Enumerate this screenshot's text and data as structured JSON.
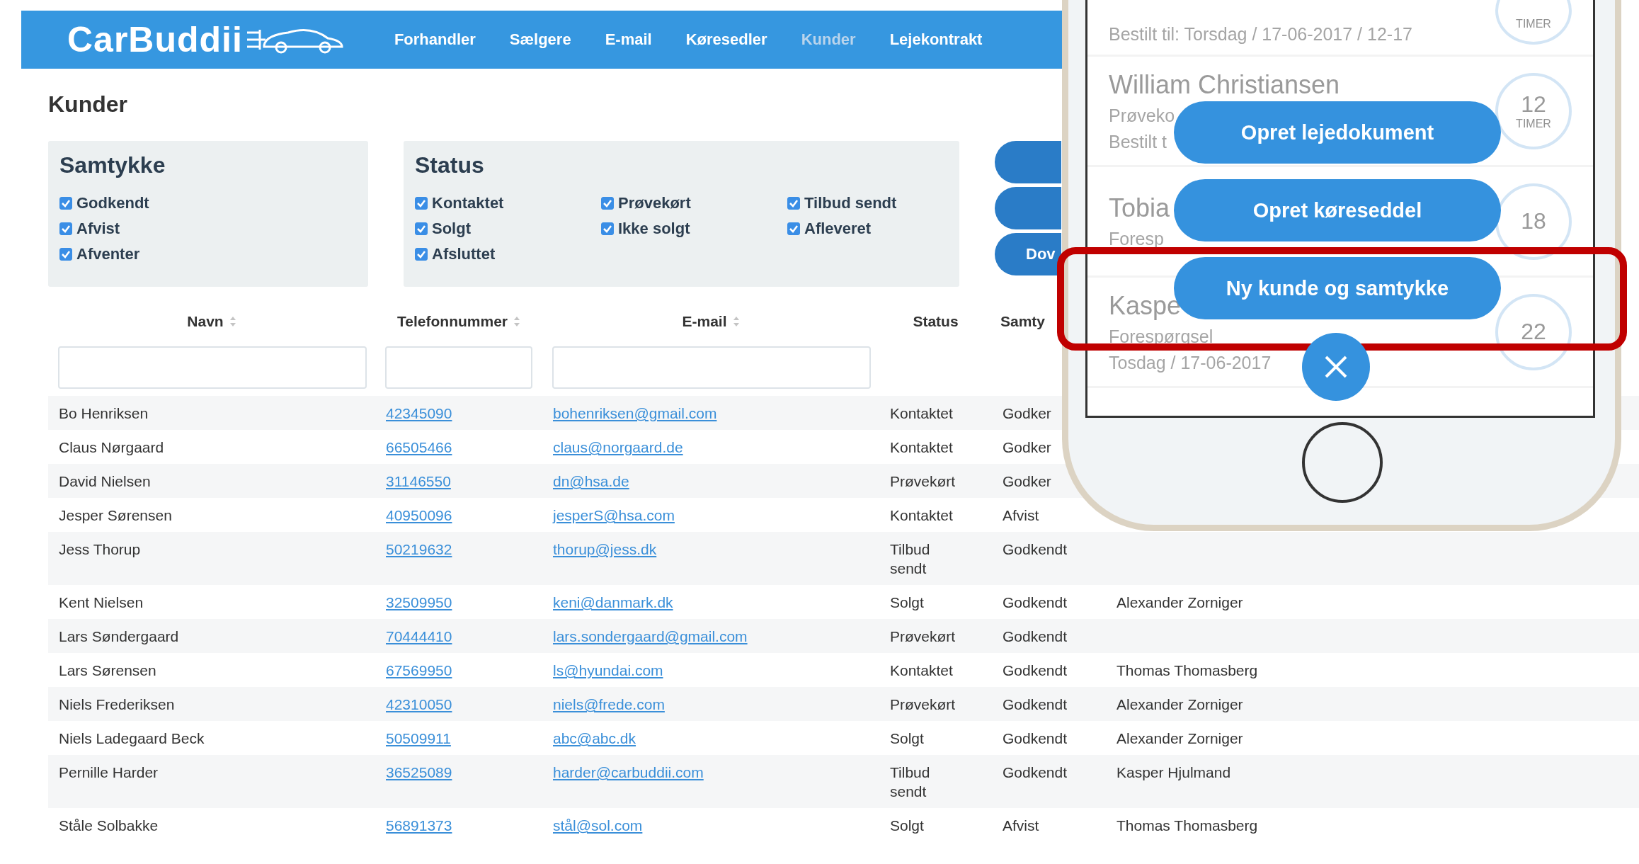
{
  "navbar": {
    "logo": "CarBuddii",
    "items": [
      {
        "label": "Forhandler",
        "selected": false
      },
      {
        "label": "Sælgere",
        "selected": false
      },
      {
        "label": "E-mail",
        "selected": false
      },
      {
        "label": "Køresedler",
        "selected": false
      },
      {
        "label": "Kunder",
        "selected": true
      },
      {
        "label": "Lejekontrakt",
        "selected": false
      }
    ]
  },
  "page_title": "Kunder",
  "filters": [
    {
      "title": "Samtykke",
      "items": [
        {
          "label": "Godkendt",
          "checked": true
        },
        {
          "label": "Afvist",
          "checked": true
        },
        {
          "label": "Afventer",
          "checked": true
        }
      ]
    },
    {
      "title": "Status",
      "items": [
        {
          "label": "Kontaktet",
          "checked": true
        },
        {
          "label": "Prøvekørt",
          "checked": true
        },
        {
          "label": "Tilbud sendt",
          "checked": true
        },
        {
          "label": "Solgt",
          "checked": true
        },
        {
          "label": "Ikke solgt",
          "checked": true
        },
        {
          "label": "Afleveret",
          "checked": true
        },
        {
          "label": "Afsluttet",
          "checked": true
        }
      ]
    }
  ],
  "side_buttons": [
    {
      "kind": "blank"
    },
    {
      "kind": "blank"
    },
    {
      "kind": "labeled",
      "label": "Dov"
    }
  ],
  "table": {
    "columns": [
      {
        "label": "Navn",
        "sortable": true,
        "filter": true
      },
      {
        "label": "Telefonnummer",
        "sortable": true,
        "filter": true
      },
      {
        "label": "E-mail",
        "sortable": true,
        "filter": true
      },
      {
        "label": "Status",
        "sortable": false,
        "filter": false
      },
      {
        "label": "Samty",
        "sortable": false,
        "filter": false
      }
    ],
    "rows": [
      {
        "name": "Bo Henriksen",
        "phone": "42345090",
        "email": "bohenriksen@gmail.com",
        "status": "Kontaktet",
        "consent": "Godker"
      },
      {
        "name": "Claus Nørgaard",
        "phone": "66505466",
        "email": "claus@norgaard.de",
        "status": "Kontaktet",
        "consent": "Godker"
      },
      {
        "name": "David Nielsen",
        "phone": "31146550",
        "email": "dn@hsa.de",
        "status": "Prøvekørt",
        "consent": "Godker"
      },
      {
        "name": "Jesper Sørensen",
        "phone": "40950096",
        "email": "jesperS@hsa.com",
        "status": "Kontaktet",
        "consent": "Afvist"
      },
      {
        "name": "Jess Thorup",
        "phone": "50219632",
        "email": "thorup@jess.dk",
        "status": "Tilbud sendt",
        "consent": "Godkendt"
      },
      {
        "name": "Kent Nielsen",
        "phone": "32509950",
        "email": "keni@danmark.dk",
        "status": "Solgt",
        "consent": "Godkendt",
        "seller": "Alexander Zorniger"
      },
      {
        "name": "Lars Søndergaard",
        "phone": "70444410",
        "email": "lars.sondergaard@gmail.com",
        "status": "Prøvekørt",
        "consent": "Godkendt"
      },
      {
        "name": "Lars Sørensen",
        "phone": "67569950",
        "email": "ls@hyundai.com",
        "status": "Kontaktet",
        "consent": "Godkendt",
        "seller": "Thomas Thomasberg"
      },
      {
        "name": "Niels Frederiksen",
        "phone": "42310050",
        "email": "niels@frede.com",
        "status": "Prøvekørt",
        "consent": "Godkendt",
        "seller": "Alexander Zorniger"
      },
      {
        "name": "Niels Ladegaard Beck",
        "phone": "50509911",
        "email": "abc@abc.dk",
        "status": "Solgt",
        "consent": "Godkendt",
        "seller": "Alexander Zorniger"
      },
      {
        "name": "Pernille Harder",
        "phone": "36525089",
        "email": "harder@carbuddii.com",
        "status": "Tilbud sendt",
        "consent": "Godkendt",
        "seller": "Kasper Hjulmand"
      },
      {
        "name": "Ståle Solbakke",
        "phone": "56891373",
        "email": "stål@sol.com",
        "status": "Solgt",
        "consent": "Afvist",
        "seller": "Thomas Thomasberg"
      }
    ]
  },
  "phone": {
    "list": [
      {
        "lines": [
          "Bestilt til: Torsdag / 17-06-2017 / 12-17"
        ],
        "ring_unit": "TIMER"
      },
      {
        "title": "William Christiansen",
        "lines": [
          "Prøveko",
          "Bestilt t"
        ],
        "ring_value": "12",
        "ring_unit": "TIMER"
      },
      {
        "title": "Tobia",
        "lines": [
          "Foresp"
        ],
        "ring_value": "18"
      },
      {
        "title": "Kaspe",
        "lines": [
          "Forespørgsel",
          "Tosdag / 17-06-2017"
        ],
        "ring_value": "22"
      }
    ],
    "actions": [
      {
        "label": "Opret lejedokument",
        "highlighted": false
      },
      {
        "label": "Opret køreseddel",
        "highlighted": false
      },
      {
        "label": "Ny kunde og samtykke",
        "highlighted": true
      }
    ]
  }
}
